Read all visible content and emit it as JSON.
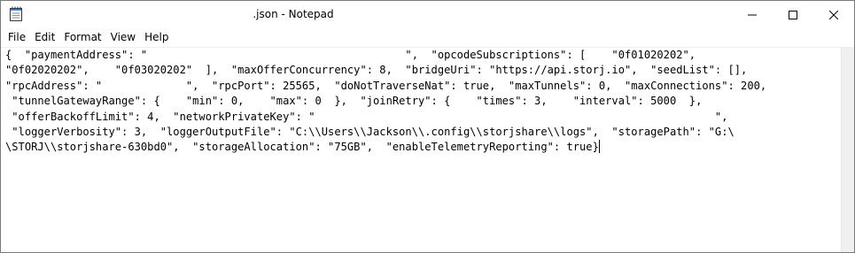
{
  "window": {
    "title": ".json - Notepad",
    "icon": "notepad-icon"
  },
  "controls": {
    "minimize_icon": "minimize-icon",
    "maximize_icon": "maximize-icon",
    "close_icon": "close-icon"
  },
  "menu": [
    "File",
    "Edit",
    "Format",
    "View",
    "Help"
  ],
  "editor": {
    "lines": [
      "{  \"paymentAddress\": \"                                        \",  \"opcodeSubscriptions\": [    \"0f01020202\",",
      "\"0f02020202\",    \"0f03020202\"  ],  \"maxOfferConcurrency\": 8,  \"bridgeUri\": \"https://api.storj.io\",  \"seedList\": [],",
      "\"rpcAddress\": \"             \",  \"rpcPort\": 25565,  \"doNotTraverseNat\": true,  \"maxTunnels\": 0,  \"maxConnections\": 200,",
      " \"tunnelGatewayRange\": {    \"min\": 0,    \"max\": 0  },  \"joinRetry\": {    \"times\": 3,    \"interval\": 5000  },",
      " \"offerBackoffLimit\": 4,  \"networkPrivateKey\": \"                                                              \",",
      " \"loggerVerbosity\": 3,  \"loggerOutputFile\": \"C:\\\\Users\\\\Jackson\\\\.config\\\\storjshare\\\\logs\",  \"storagePath\": \"G:\\",
      "\\STORJ\\\\storjshare-630bd0\",  \"storageAllocation\": \"75GB\",  \"enableTelemetryReporting\": true}"
    ]
  },
  "colors": {
    "background": "#ffffff",
    "scrollbar": "#f0f0f0",
    "text": "#000000"
  }
}
